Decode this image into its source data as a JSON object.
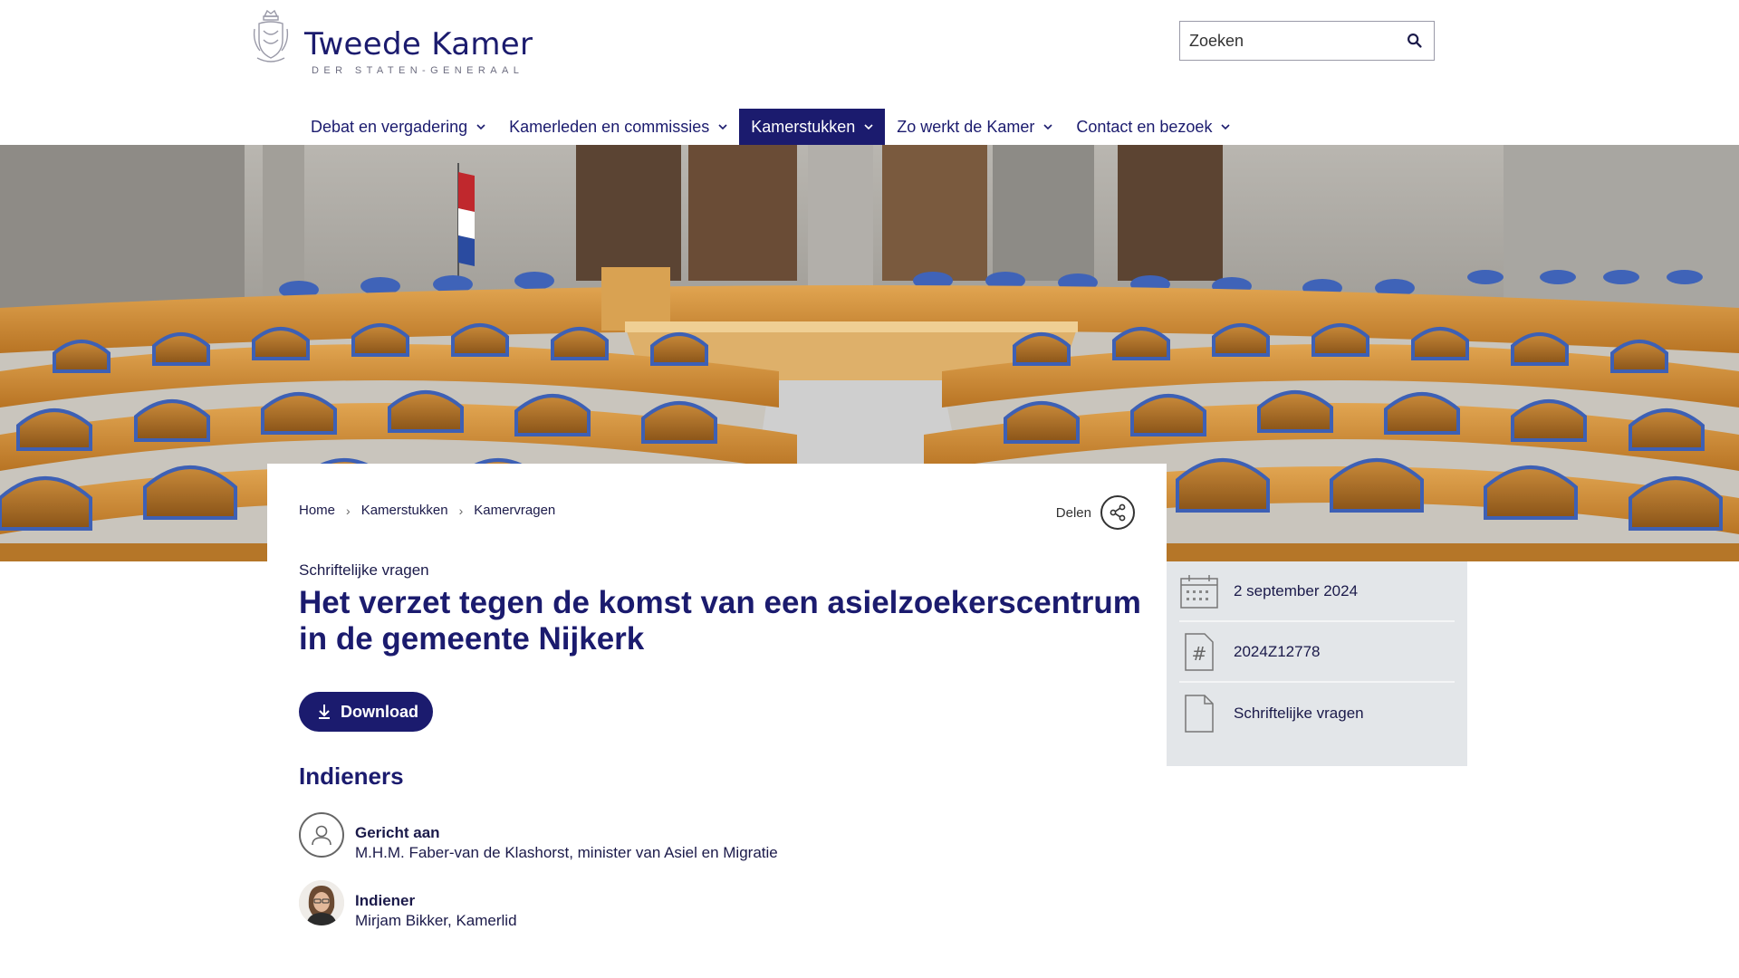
{
  "header": {
    "logo_title": "Tweede Kamer",
    "logo_subtitle": "DER STATEN-GENERAAL",
    "search_placeholder": "Zoeken"
  },
  "nav": {
    "items": [
      {
        "label": "Debat en vergadering",
        "active": false
      },
      {
        "label": "Kamerleden en commissies",
        "active": false
      },
      {
        "label": "Kamerstukken",
        "active": true
      },
      {
        "label": "Zo werkt de Kamer",
        "active": false
      },
      {
        "label": "Contact en bezoek",
        "active": false
      }
    ]
  },
  "breadcrumb": [
    "Home",
    "Kamerstukken",
    "Kamervragen"
  ],
  "share_label": "Delen",
  "document": {
    "type": "Schriftelijke vragen",
    "title": "Het verzet tegen de komst van een asielzoekerscentrum in de gemeente Nijkerk",
    "download_label": "Download"
  },
  "indieners": {
    "heading": "Indieners",
    "people": [
      {
        "role": "Gericht aan",
        "name": "M.H.M. Faber-van de Klashorst, minister van Asiel en Migratie",
        "avatar": "person-outline-icon"
      },
      {
        "role": "Indiener",
        "name": "Mirjam Bikker, Kamerlid",
        "avatar": "photo"
      }
    ]
  },
  "meta": {
    "date": "2 september 2024",
    "number": "2024Z12778",
    "kind": "Schriftelijke vragen"
  },
  "colors": {
    "brand": "#1b1b6e",
    "meta_bg": "#e3e6e9"
  }
}
